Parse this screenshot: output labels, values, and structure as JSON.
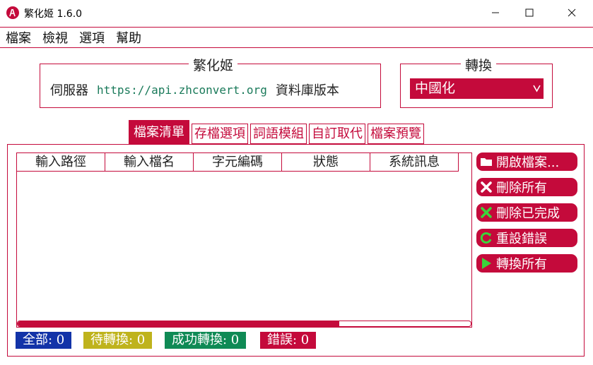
{
  "window": {
    "title": "繁化姬 1.6.0",
    "icon": "fanhuaji-logo-icon",
    "minimize": "—",
    "maximize": "☐",
    "close": "✕"
  },
  "menu": [
    "檔案",
    "檢視",
    "選項",
    "幫助"
  ],
  "main_group": {
    "title": "繁化姬",
    "server_label": "伺服器",
    "server_url": "https://api.zhconvert.org",
    "db_version_label": "資料庫版本"
  },
  "convert_group": {
    "title": "轉換",
    "selected": "中國化"
  },
  "tabs": [
    "檔案清單",
    "存檔選項",
    "詞語模組",
    "自訂取代",
    "檔案預覽"
  ],
  "file_list": {
    "columns": [
      "輸入路徑",
      "輸入檔名",
      "字元編碼",
      "狀態",
      "系統訊息"
    ],
    "rows": [],
    "scroll_position": 0.71
  },
  "actions": {
    "open_files": "開啟檔案...",
    "delete_all": "刪除所有",
    "delete_completed": "刪除已完成",
    "reset_errors": "重設錯誤",
    "convert_all": "轉換所有"
  },
  "status": {
    "all": "全部: 0",
    "pending": "待轉換: 0",
    "success": "成功轉換: 0",
    "error": "錯誤: 0"
  },
  "colors": {
    "accent": "#c40a3b",
    "all": "#1233a8",
    "pending": "#bfb31c",
    "success": "#0f8a55",
    "error": "#c40a3b",
    "url": "#1a7a5a"
  }
}
